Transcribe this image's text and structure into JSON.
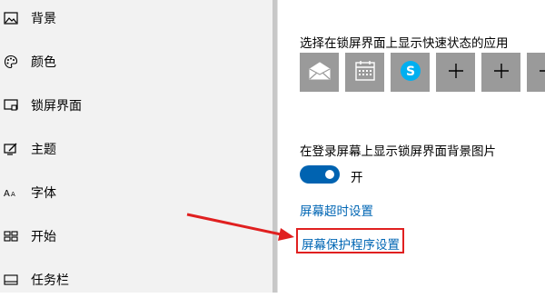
{
  "sidebar": {
    "items": [
      {
        "label": "背景",
        "icon": "picture-icon"
      },
      {
        "label": "颜色",
        "icon": "palette-icon"
      },
      {
        "label": "锁屏界面",
        "icon": "lock-screen-icon"
      },
      {
        "label": "主题",
        "icon": "theme-icon"
      },
      {
        "label": "字体",
        "icon": "font-icon"
      },
      {
        "label": "开始",
        "icon": "start-icon"
      },
      {
        "label": "任务栏",
        "icon": "taskbar-icon"
      }
    ]
  },
  "main": {
    "quick_status_title": "选择在锁屏界面上显示快速状态的应用",
    "app_tiles": [
      {
        "icon": "mail-icon"
      },
      {
        "icon": "calendar-icon"
      },
      {
        "icon": "skype-icon"
      },
      {
        "icon": "plus-icon"
      },
      {
        "icon": "plus-icon"
      },
      {
        "icon": "plus-icon"
      }
    ],
    "background_title": "在登录屏幕上显示锁屏界面背景图片",
    "toggle_state": "开",
    "toggle_on": true,
    "timeout_link": "屏幕超时设置",
    "screensaver_link": "屏幕保护程序设置"
  },
  "colors": {
    "accent": "#0063b1",
    "link": "#0066b4",
    "tile": "#9a9a9a",
    "highlight": "#e02020",
    "arrow": "#e02020",
    "skype": "#00aff0"
  }
}
